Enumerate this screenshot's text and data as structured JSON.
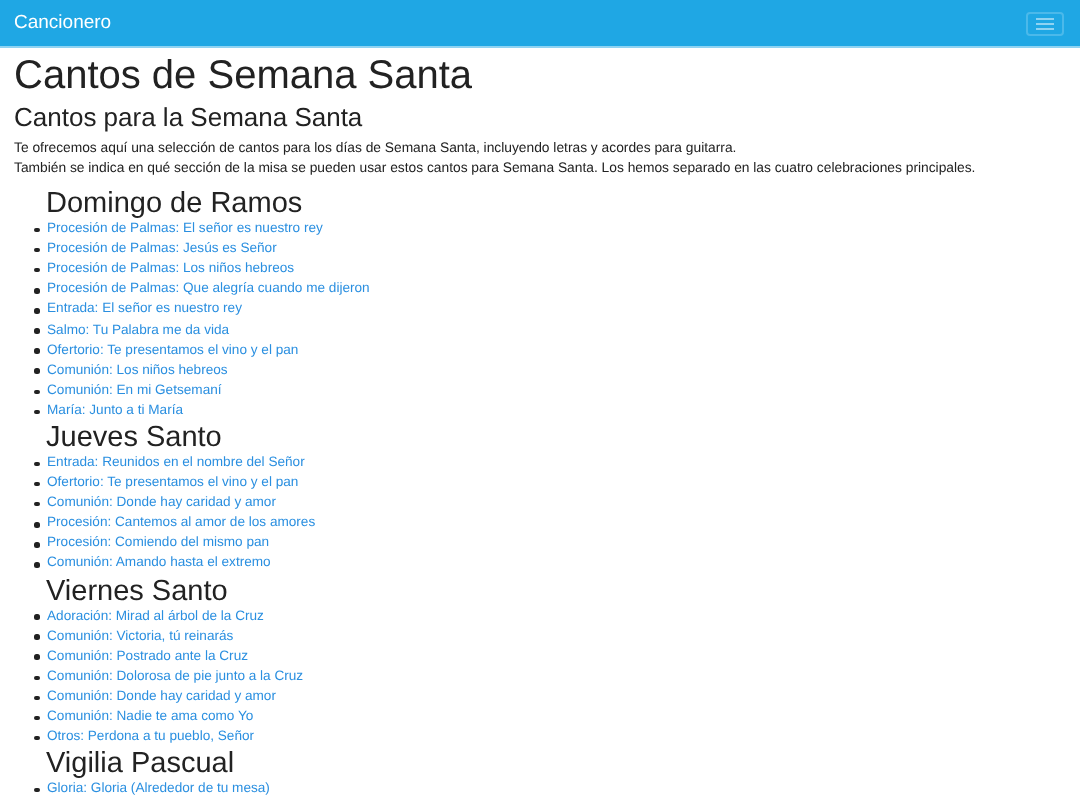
{
  "navbar": {
    "brand": "Cancionero"
  },
  "title": "Cantos de Semana Santa",
  "subtitle": "Cantos para la Semana Santa",
  "intro": [
    "Te ofrecemos aquí una selección de cantos para los días de Semana Santa, incluyendo letras y acordes para guitarra.",
    "También se indica en qué sección de la misa se pueden usar estos cantos para Semana Santa. Los hemos separado en las cuatro celebraciones principales."
  ],
  "sections": [
    {
      "heading": "Domingo de Ramos",
      "songs": [
        "Procesión de Palmas: El señor es nuestro rey",
        "Procesión de Palmas: Jesús es Señor",
        "Procesión de Palmas: Los niños hebreos",
        "Procesión de Palmas: Que alegría cuando me dijeron",
        "Entrada: El señor es nuestro rey",
        "Salmo: Tu Palabra me da vida",
        "Ofertorio: Te presentamos el vino y el pan",
        "Comunión: Los niños hebreos",
        "Comunión: En mi Getsemaní",
        "María: Junto a ti María"
      ]
    },
    {
      "heading": "Jueves Santo",
      "songs": [
        "Entrada: Reunidos en el nombre del Señor",
        "Ofertorio: Te presentamos el vino y el pan",
        "Comunión: Donde hay caridad y amor",
        "Procesión: Cantemos al amor de los amores",
        "Procesión: Comiendo del mismo pan",
        "Comunión: Amando hasta el extremo"
      ]
    },
    {
      "heading": "Viernes Santo",
      "songs": [
        "Adoración: Mirad al árbol de la Cruz",
        "Comunión: Victoria, tú reinarás",
        "Comunión: Postrado ante la Cruz",
        "Comunión: Dolorosa de pie junto a la Cruz",
        "Comunión: Donde hay caridad y amor",
        "Comunión: Nadie te ama como Yo",
        "Otros: Perdona a tu pueblo, Señor"
      ]
    },
    {
      "heading": "Vigilia Pascual",
      "songs": [
        "Gloria: Gloria (Alrededor de tu mesa)"
      ]
    }
  ]
}
